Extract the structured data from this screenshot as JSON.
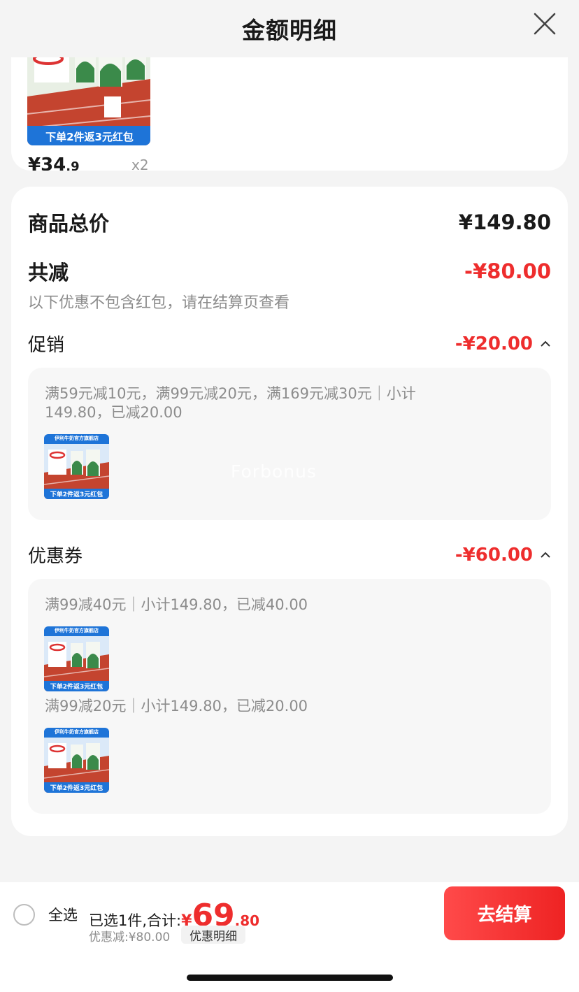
{
  "header": {
    "title": "金额明细"
  },
  "product": {
    "price_int": "¥34",
    "price_dec": ".9",
    "qty": "x2",
    "banner_text": "下单2件返3元红包"
  },
  "summary": {
    "total_label": "商品总价",
    "total_value": "¥149.80",
    "reduce_label": "共减",
    "reduce_value": "-¥80.00",
    "note": "以下优惠不包含红包，请在结算页查看"
  },
  "promo": {
    "label": "促销",
    "value": "-¥20.00",
    "desc": "满59元减10元，满99元减20元，满169元减30元｜小计149.80，已减20.00"
  },
  "coupon": {
    "label": "优惠券",
    "value": "-¥60.00",
    "items": [
      {
        "desc": "满99减40元｜小计149.80，已减40.00"
      },
      {
        "desc": "满99减20元｜小计149.80，已减20.00"
      }
    ]
  },
  "thumb": {
    "shop_text": "伊利牛奶官方旗舰店",
    "banner_text": "下单2件返3元红包"
  },
  "watermark": "Forbonus",
  "bottom": {
    "select_all": "全选",
    "selected_label": "已选1件,合计:",
    "currency": "¥",
    "total_int": "69",
    "total_dec": ".80",
    "discount": "优惠减:¥80.00",
    "detail_button": "优惠明细",
    "checkout_button": "去结算"
  },
  "colors": {
    "accent_red": "#ee2d2d",
    "track_red": "#c4442f",
    "banner_blue": "#1e74d8"
  },
  "icons": [
    "close-icon",
    "chevron-up-icon",
    "radio-unchecked-icon"
  ]
}
